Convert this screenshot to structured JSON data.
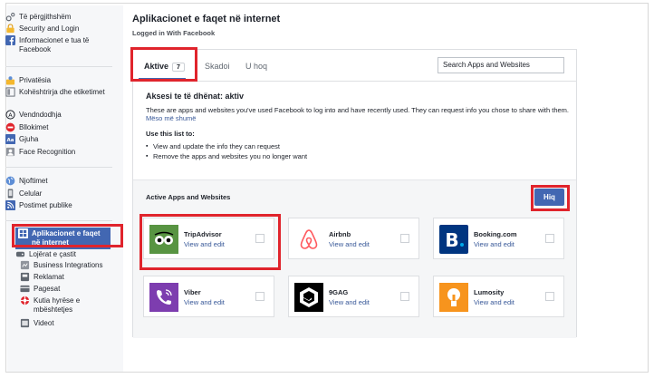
{
  "sidebar": {
    "items": [
      {
        "label": "Të përgjithshëm",
        "icon": "gear-icon"
      },
      {
        "label": "Security and Login",
        "icon": "shield-icon"
      },
      {
        "label": "Informacionet e tua të Facebook",
        "icon": "facebook-icon"
      },
      {
        "label": "Privatësia",
        "icon": "lock-icon"
      },
      {
        "label": "Kohështrirja dhe etiketimet",
        "icon": "timeline-icon"
      },
      {
        "label": "Vendndodhja",
        "icon": "location-icon"
      },
      {
        "label": "Bllokimet",
        "icon": "block-icon"
      },
      {
        "label": "Gjuha",
        "icon": "language-icon"
      },
      {
        "label": "Face Recognition",
        "icon": "face-recognition-icon"
      },
      {
        "label": "Njoftimet",
        "icon": "globe-icon"
      },
      {
        "label": "Celular",
        "icon": "mobile-icon"
      },
      {
        "label": "Postimet publike",
        "icon": "rss-icon"
      },
      {
        "label": "Aplikacionet e faqet në internet",
        "icon": "apps-icon"
      },
      {
        "label": "Lojërat e çastit",
        "icon": "games-icon"
      },
      {
        "label": "Business Integrations",
        "icon": "business-icon"
      },
      {
        "label": "Reklamat",
        "icon": "ads-icon"
      },
      {
        "label": "Pagesat",
        "icon": "card-icon"
      },
      {
        "label": "Kutia hyrëse e mbështetjes",
        "icon": "lifebuoy-icon"
      },
      {
        "label": "Videot",
        "icon": "video-icon"
      }
    ]
  },
  "header": {
    "title": "Aplikacionet e faqet në internet",
    "subtitle": "Logged in With Facebook"
  },
  "tabs": [
    {
      "label": "Aktive",
      "count": "7"
    },
    {
      "label": "Skadoi"
    },
    {
      "label": "U hoq"
    }
  ],
  "search": {
    "value": "Search Apps and Websites"
  },
  "info": {
    "title": "Aksesi te të dhënat: aktiv",
    "text": "These are apps and websites you've used Facebook to log into and have recently used. They can request info you chose to share with them.",
    "link": "Mëso më shumë",
    "use_title": "Use this list to:",
    "bullets": [
      "View and update the info they can request",
      "Remove the apps and websites you no longer want"
    ]
  },
  "section": {
    "title": "Active Apps and Websites",
    "remove_button": "Hiq"
  },
  "apps": [
    {
      "name": "TripAdvisor",
      "link": "View and edit",
      "icon": "tripadvisor-logo-icon",
      "color": "#589442"
    },
    {
      "name": "Airbnb",
      "link": "View and edit",
      "icon": "airbnb-logo-icon",
      "color": "#ff5a5f"
    },
    {
      "name": "Booking.com",
      "link": "View and edit",
      "icon": "booking-logo-icon",
      "color": "#003580"
    },
    {
      "name": "Viber",
      "link": "View and edit",
      "icon": "viber-logo-icon",
      "color": "#7d3daf"
    },
    {
      "name": "9GAG",
      "link": "View and edit",
      "icon": "9gag-logo-icon",
      "color": "#000000"
    },
    {
      "name": "Lumosity",
      "link": "View and edit",
      "icon": "lumosity-logo-icon",
      "color": "#f7941d"
    }
  ],
  "colors": {
    "accent": "#4267b2",
    "highlight": "#e0242c",
    "link": "#385898"
  }
}
